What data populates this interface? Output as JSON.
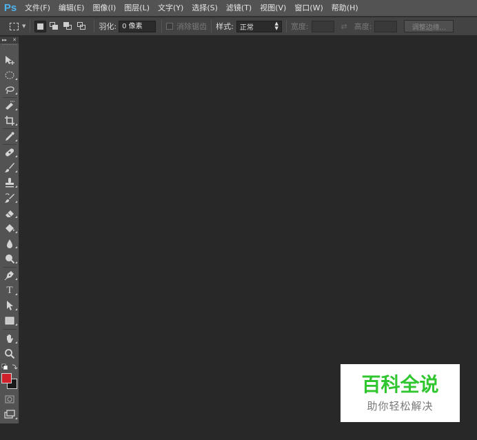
{
  "app": {
    "logo": "Ps"
  },
  "menu": [
    {
      "label": "文件(F)"
    },
    {
      "label": "编辑(E)"
    },
    {
      "label": "图像(I)"
    },
    {
      "label": "图层(L)"
    },
    {
      "label": "文字(Y)"
    },
    {
      "label": "选择(S)"
    },
    {
      "label": "滤镜(T)"
    },
    {
      "label": "视图(V)"
    },
    {
      "label": "窗口(W)"
    },
    {
      "label": "帮助(H)"
    }
  ],
  "options": {
    "feather_label": "羽化:",
    "feather_value": "0 像素",
    "antialias_label": "消除锯齿",
    "antialias_checked": false,
    "style_label": "样式:",
    "style_value": "正常",
    "width_label": "宽度:",
    "height_label": "高度:",
    "refine_edge_label": "调整边缘..."
  },
  "toolbox": {
    "tools": [
      {
        "name": "move-tool",
        "icon": "move-icon"
      },
      {
        "name": "marquee-tool",
        "icon": "elliptical-marquee-icon"
      },
      {
        "name": "lasso-tool",
        "icon": "lasso-icon"
      },
      {
        "name": "quick-selection-tool",
        "icon": "quick-selection-icon"
      },
      {
        "name": "crop-tool",
        "icon": "crop-icon"
      },
      {
        "name": "eyedropper-tool",
        "icon": "eyedropper-icon"
      },
      {
        "name": "healing-brush-tool",
        "icon": "bandage-icon"
      },
      {
        "name": "brush-tool",
        "icon": "brush-icon"
      },
      {
        "name": "clone-stamp-tool",
        "icon": "stamp-icon"
      },
      {
        "name": "history-brush-tool",
        "icon": "history-brush-icon"
      },
      {
        "name": "eraser-tool",
        "icon": "eraser-icon"
      },
      {
        "name": "paint-bucket-tool",
        "icon": "paint-bucket-icon"
      },
      {
        "name": "blur-tool",
        "icon": "droplet-icon"
      },
      {
        "name": "dodge-tool",
        "icon": "dodge-icon"
      },
      {
        "name": "pen-tool",
        "icon": "pen-icon"
      },
      {
        "name": "type-tool",
        "icon": "type-icon",
        "glyph": "T"
      },
      {
        "name": "path-selection-tool",
        "icon": "arrow-icon"
      },
      {
        "name": "shape-tool",
        "icon": "rectangle-icon"
      },
      {
        "name": "hand-tool",
        "icon": "hand-icon"
      },
      {
        "name": "zoom-tool",
        "icon": "magnifier-icon"
      }
    ],
    "foreground_color": "#d0202a",
    "background_color": "#1a1a1a"
  },
  "watermark": {
    "title": "百科全说",
    "subtitle": "助你轻松解决",
    "title_color": "#2fc62f"
  }
}
